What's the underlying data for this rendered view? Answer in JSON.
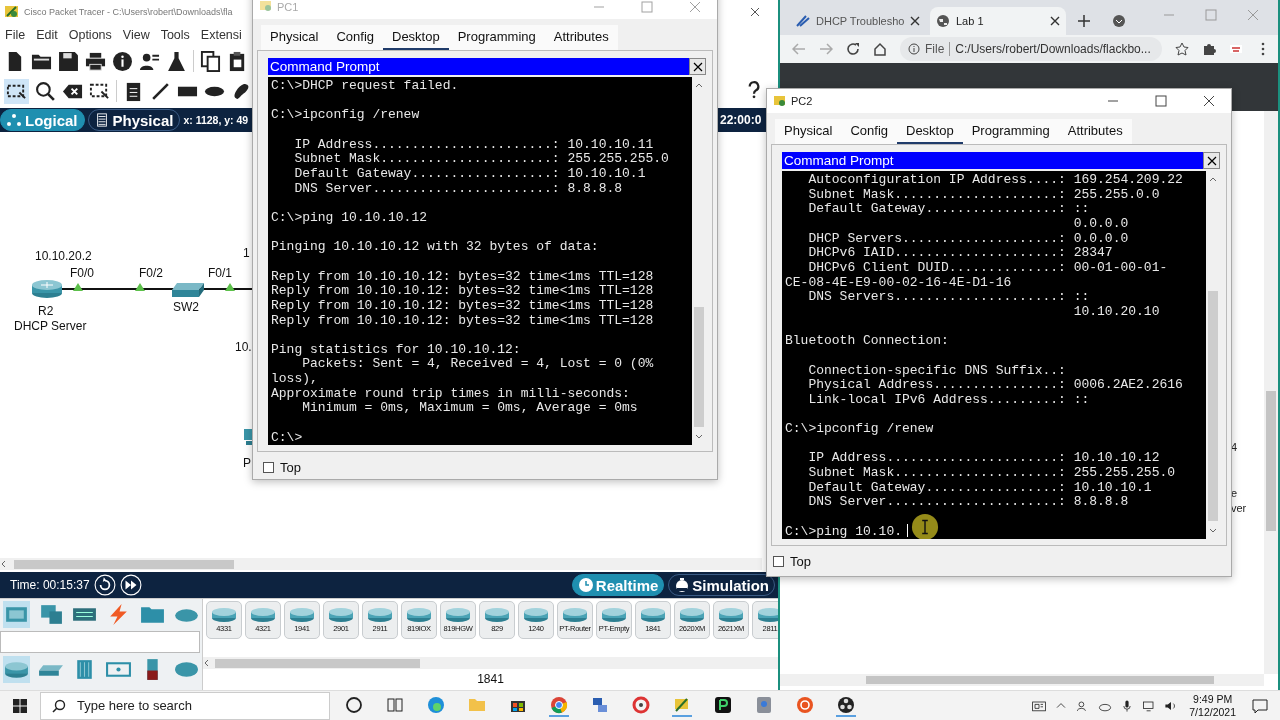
{
  "packet_tracer": {
    "title": "Cisco Packet Tracer - C:\\Users\\robert\\Downloads\\fla",
    "menu": [
      "File",
      "Edit",
      "Options",
      "View",
      "Tools",
      "Extensi"
    ],
    "workspace_tabs": [
      {
        "label": "Logical",
        "selected": true
      },
      {
        "label": "Physical",
        "selected": false
      }
    ],
    "coordinates": "x: 1128, y: 49",
    "clock_fragment": "22:00:0",
    "router": {
      "ip": "10.10.20.2",
      "name": "R2",
      "role": "DHCP Server"
    },
    "switch": {
      "name": "SW2"
    },
    "ports": [
      "F0/0",
      "F0/2",
      "F0/1"
    ],
    "cut_labels": [
      "1",
      "10.",
      "P"
    ],
    "time": "Time: 00:15:37",
    "modes": [
      {
        "label": "Realtime",
        "selected": true
      },
      {
        "label": "Simulation",
        "selected": false
      }
    ],
    "devices": [
      "4331",
      "4321",
      "1941",
      "2901",
      "2911",
      "819IOX",
      "819HGW",
      "829",
      "1240",
      "PT-Router",
      "PT-Empty",
      "1841",
      "2620XM",
      "2621XM",
      "2811"
    ],
    "selected_device": "1841"
  },
  "browser": {
    "tabs": [
      {
        "label": "DHCP Troublesho",
        "selected": false
      },
      {
        "label": "Lab 1",
        "selected": true
      }
    ],
    "address_scheme": "File",
    "address": "C:/Users/robert/Downloads/flackbo...",
    "page_fragments": [
      "4",
      "e",
      "ver"
    ]
  },
  "pc1": {
    "title": "PC1",
    "active": false,
    "tabs": [
      {
        "label": "Physical",
        "selected": false
      },
      {
        "label": "Config",
        "selected": false
      },
      {
        "label": "Desktop",
        "selected": true
      },
      {
        "label": "Programming",
        "selected": false
      },
      {
        "label": "Attributes",
        "selected": false
      }
    ],
    "prompt_title": "Command Prompt",
    "output": "C:\\>DHCP request failed.\n\nC:\\>ipconfig /renew\n\n   IP Address.......................: 10.10.10.11\n   Subnet Mask......................: 255.255.255.0\n   Default Gateway..................: 10.10.10.1\n   DNS Server.......................: 8.8.8.8\n\nC:\\>ping 10.10.10.12\n\nPinging 10.10.10.12 with 32 bytes of data:\n\nReply from 10.10.10.12: bytes=32 time<1ms TTL=128\nReply from 10.10.10.12: bytes=32 time<1ms TTL=128\nReply from 10.10.10.12: bytes=32 time<1ms TTL=128\nReply from 10.10.10.12: bytes=32 time<1ms TTL=128\n\nPing statistics for 10.10.10.12:\n    Packets: Sent = 4, Received = 4, Lost = 0 (0%\nloss),\nApproximate round trip times in milli-seconds:\n    Minimum = 0ms, Maximum = 0ms, Average = 0ms\n\nC:\\>",
    "top_label": "Top",
    "top_checked": false
  },
  "pc2": {
    "title": "PC2",
    "active": true,
    "tabs": [
      {
        "label": "Physical",
        "selected": false
      },
      {
        "label": "Config",
        "selected": false
      },
      {
        "label": "Desktop",
        "selected": true
      },
      {
        "label": "Programming",
        "selected": false
      },
      {
        "label": "Attributes",
        "selected": false
      }
    ],
    "prompt_title": "Command Prompt",
    "output": "   Autoconfiguration IP Address....: 169.254.209.22\n   Subnet Mask.....................: 255.255.0.0\n   Default Gateway.................: ::\n                                     0.0.0.0\n   DHCP Servers....................: 0.0.0.0\n   DHCPv6 IAID.....................: 28347\n   DHCPv6 Client DUID..............: 00-01-00-01-\nCE-08-4E-E9-00-02-16-4E-D1-16\n   DNS Servers.....................: ::\n                                     10.10.20.10\n\nBluetooth Connection:\n\n   Connection-specific DNS Suffix..:\n   Physical Address................: 0006.2AE2.2616\n   Link-local IPv6 Address.........: ::\n\nC:\\>ipconfig /renew\n\n   IP Address......................: 10.10.10.12\n   Subnet Mask.....................: 255.255.255.0\n   Default Gateway.................: 10.10.10.1\n   DNS Server......................: 8.8.8.8\n\nC:\\>ping 10.10.",
    "top_label": "Top",
    "top_checked": false
  },
  "taskbar": {
    "search_placeholder": "Type here to search",
    "time": "9:49 PM",
    "date": "7/12/2021"
  }
}
